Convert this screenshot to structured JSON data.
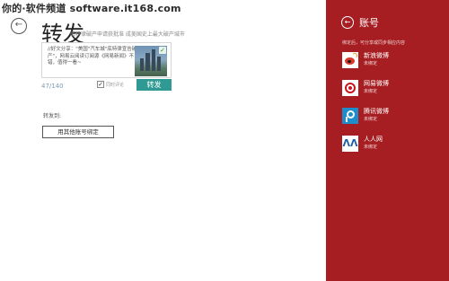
{
  "watermark": "你的·软件频道 software.it168.com",
  "main": {
    "title": "转发",
    "subtitle": "底特律破产申请获批准 成美国史上最大破产城市",
    "share_card": {
      "text": "//好文分享：\"美国\"汽车城\"底特律宣告破产\"，网易云阅读订阅源《网易新闻》不错，值得一看~"
    },
    "char_count": "47/140",
    "comment_checkbox": {
      "checked": true,
      "label": "同时评论"
    },
    "forward_button": "转发",
    "forward_to_label": "转发到:",
    "bind_other_button": "用其他账号绑定"
  },
  "panel": {
    "title": "账号",
    "note": "绑定后，可分享或同步相应内容",
    "accounts": [
      {
        "name": "新浪微博",
        "status": "未绑定",
        "icon": "sina-weibo-icon"
      },
      {
        "name": "网易微博",
        "status": "未绑定",
        "icon": "netease-weibo-icon"
      },
      {
        "name": "腾讯微博",
        "status": "未绑定",
        "icon": "tencent-weibo-icon"
      },
      {
        "name": "人人网",
        "status": "未绑定",
        "icon": "renren-icon"
      }
    ]
  },
  "colors": {
    "panel_bg": "#a61e22",
    "accent_teal": "#2f9a94"
  }
}
